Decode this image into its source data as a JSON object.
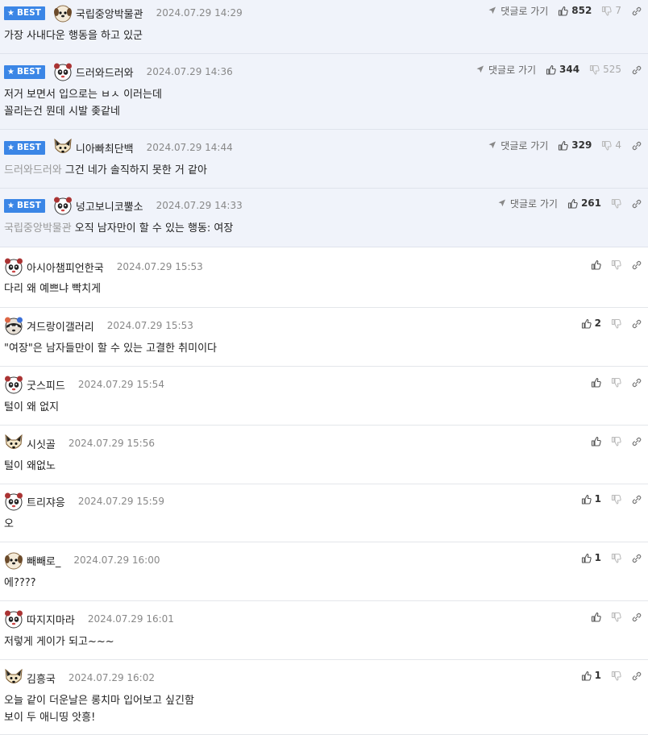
{
  "labels": {
    "best": "BEST",
    "goto": "댓글로 가기"
  },
  "colors": {
    "best_badge": "#3b86e6",
    "best_bg": "#f0f3fa"
  },
  "comments": [
    {
      "best": true,
      "avatar": "dog-face-avatar",
      "nick": "국립중앙박물관",
      "date": "2024.07.29 14:29",
      "likes": "852",
      "dislikes": "7",
      "mention": "",
      "text": "가장 사내다운 행동을 하고 있군"
    },
    {
      "best": true,
      "avatar": "panda-face-avatar",
      "nick": "드러와드러와",
      "date": "2024.07.29 14:36",
      "likes": "344",
      "dislikes": "525",
      "mention": "",
      "text": "저거 보면서 입으로는 ㅂㅅ 이러는데\n꼴리는건 뭔데 시발 좆같네"
    },
    {
      "best": true,
      "avatar": "fox-face-avatar",
      "nick": "니아빠최단백",
      "date": "2024.07.29 14:44",
      "likes": "329",
      "dislikes": "4",
      "mention": "드러와드러와",
      "text": "그건 네가 솔직하지 못한 거 같아"
    },
    {
      "best": true,
      "avatar": "panda-face-avatar",
      "nick": "넝고보니코뿔소",
      "date": "2024.07.29 14:33",
      "likes": "261",
      "dislikes": "",
      "mention": "국립중앙박물관",
      "text": "오직 남자만이 할 수 있는 행동: 여장"
    },
    {
      "best": false,
      "avatar": "panda-face-avatar",
      "nick": "아시아챔피언한국",
      "date": "2024.07.29 15:53",
      "likes": "",
      "dislikes": "",
      "mention": "",
      "text": "다리 왜 예쁘냐 빡치게"
    },
    {
      "best": false,
      "avatar": "raccoon-face-avatar",
      "nick": "겨드랑이갤러리",
      "date": "2024.07.29 15:53",
      "likes": "2",
      "dislikes": "",
      "mention": "",
      "text": "\"여장\"은 남자들만이 할 수 있는 고결한 취미이다"
    },
    {
      "best": false,
      "avatar": "panda-face-avatar",
      "nick": "굿스피드",
      "date": "2024.07.29 15:54",
      "likes": "",
      "dislikes": "",
      "mention": "",
      "text": "털이 왜 없지"
    },
    {
      "best": false,
      "avatar": "fox-face-avatar",
      "nick": "시싯골",
      "date": "2024.07.29 15:56",
      "likes": "",
      "dislikes": "",
      "mention": "",
      "text": "털이 왜없노"
    },
    {
      "best": false,
      "avatar": "panda-face-avatar",
      "nick": "트리쟈응",
      "date": "2024.07.29 15:59",
      "likes": "1",
      "dislikes": "",
      "mention": "",
      "text": "오"
    },
    {
      "best": false,
      "avatar": "dog-face-avatar",
      "nick": "빼빼로_",
      "date": "2024.07.29 16:00",
      "likes": "1",
      "dislikes": "",
      "mention": "",
      "text": "에????"
    },
    {
      "best": false,
      "avatar": "panda-face-avatar",
      "nick": "따지지마라",
      "date": "2024.07.29 16:01",
      "likes": "",
      "dislikes": "",
      "mention": "",
      "text": "저렇게 게이가 되고~~~"
    },
    {
      "best": false,
      "avatar": "fox-face-avatar",
      "nick": "김흥국",
      "date": "2024.07.29 16:02",
      "likes": "1",
      "dislikes": "",
      "mention": "",
      "text": "오늘 같이 더운날은 롱치마 입어보고 싶긴함\n보이 두 애니띵 앗흥!"
    }
  ]
}
